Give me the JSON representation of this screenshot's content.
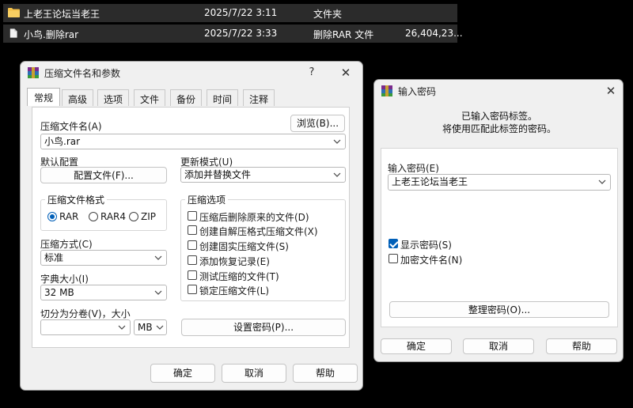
{
  "files": [
    {
      "name": "上老王论坛当老王",
      "date": "2025/7/22 3:11",
      "type": "文件夹",
      "size": "",
      "icon": "folder-icon"
    },
    {
      "name": "小鸟.删除rar",
      "date": "2025/7/22 3:33",
      "type": "删除RAR 文件",
      "size": "26,404,23...",
      "icon": "document-icon"
    }
  ],
  "archive_dialog": {
    "title": "压缩文件名和参数",
    "help": "?",
    "close": "✕",
    "tabs": [
      "常规",
      "高级",
      "选项",
      "文件",
      "备份",
      "时间",
      "注释"
    ],
    "archive_name_label": "压缩文件名(A)",
    "browse_button": "浏览(B)...",
    "archive_name_value": "小鸟.rar",
    "default_profile_label": "默认配置",
    "profiles_button": "配置文件(F)...",
    "update_mode_label": "更新模式(U)",
    "update_mode_value": "添加并替换文件",
    "format_group": "压缩文件格式",
    "formats": [
      "RAR",
      "RAR4",
      "ZIP"
    ],
    "selected_format": "RAR",
    "method_label": "压缩方式(C)",
    "method_value": "标准",
    "dict_label": "字典大小(I)",
    "dict_value": "32 MB",
    "split_label": "切分为分卷(V)，大小",
    "split_value": "",
    "split_unit": "MB",
    "options_group": "压缩选项",
    "options": [
      {
        "label": "压缩后删除原来的文件(D)",
        "checked": false
      },
      {
        "label": "创建自解压格式压缩文件(X)",
        "checked": false
      },
      {
        "label": "创建固实压缩文件(S)",
        "checked": false
      },
      {
        "label": "添加恢复记录(E)",
        "checked": false
      },
      {
        "label": "测试压缩的文件(T)",
        "checked": false
      },
      {
        "label": "锁定压缩文件(L)",
        "checked": false
      }
    ],
    "set_password_button": "设置密码(P)...",
    "ok_button": "确定",
    "cancel_button": "取消",
    "help_button": "帮助"
  },
  "password_dialog": {
    "title": "输入密码",
    "close": "✕",
    "message_line1": "已输入密码标签。",
    "message_line2": "将使用匹配此标签的密码。",
    "password_label": "输入密码(E)",
    "password_value": "上老王论坛当老王",
    "show_password_label": "显示密码(S)",
    "show_password_checked": true,
    "encrypt_names_label": "加密文件名(N)",
    "encrypt_names_checked": false,
    "organize_button": "整理密码(O)...",
    "ok_button": "确定",
    "cancel_button": "取消",
    "help_button": "帮助"
  },
  "colors": {
    "accent": "#005fb8",
    "dialog_bg": "#f0f0f0",
    "file_row_bg": "#2b2b2b",
    "folder": "#f4c14a"
  }
}
